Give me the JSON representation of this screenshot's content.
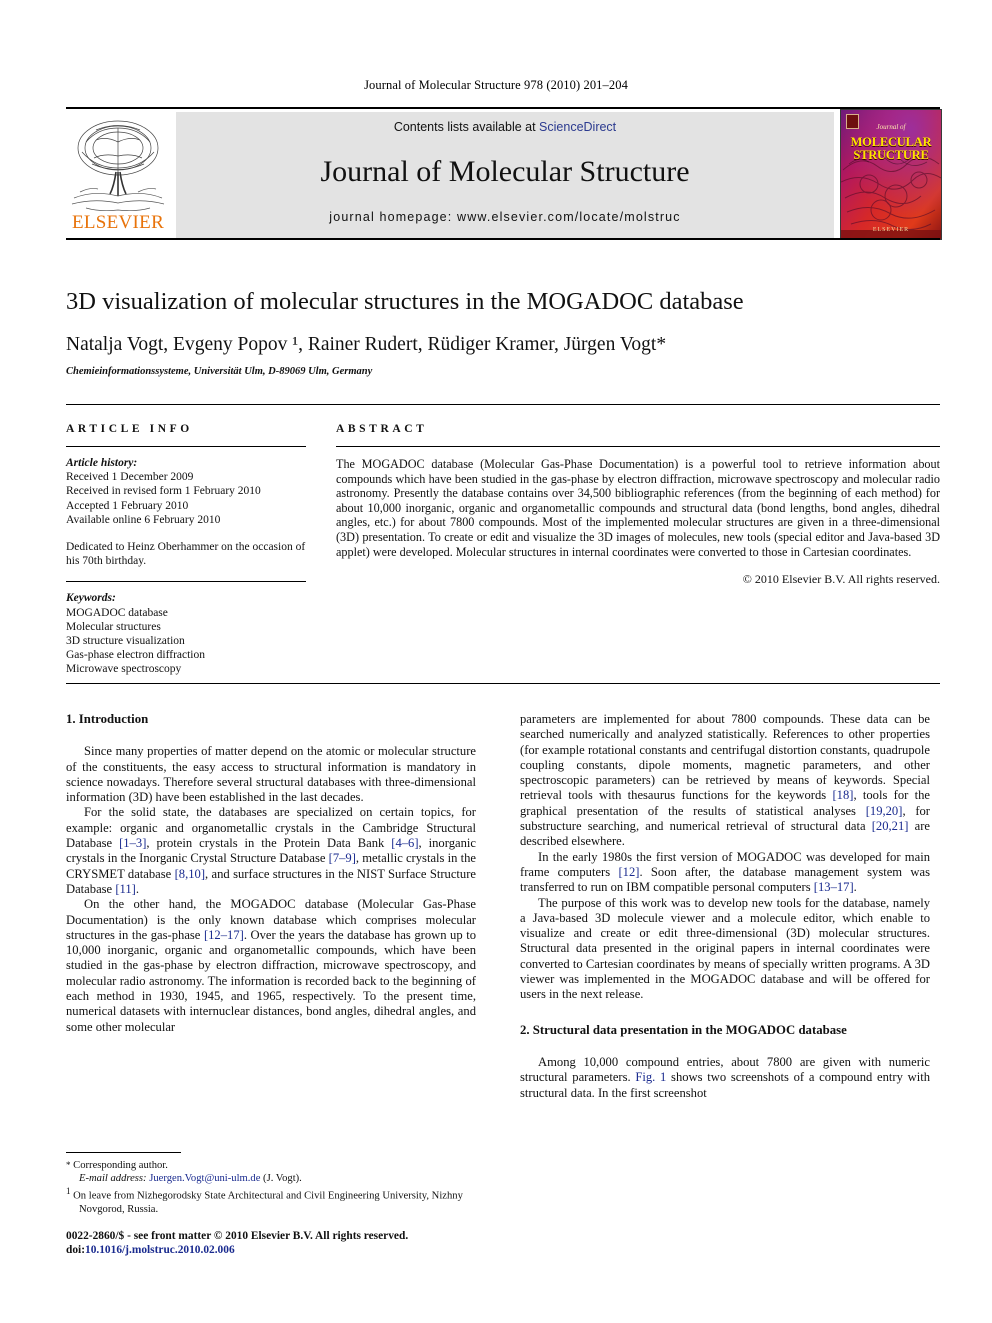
{
  "running_head": "Journal of Molecular Structure 978 (2010) 201–204",
  "masthead": {
    "contents_prefix": "Contents lists available at ",
    "sciencedirect": "ScienceDirect",
    "journal_title": "Journal of Molecular Structure",
    "homepage": "journal homepage: www.elsevier.com/locate/molstruc",
    "publisher_wordmark": "ELSEVIER",
    "cover": {
      "journal_of": "Journal of",
      "title_line1": "MOLECULAR",
      "title_line2": "STRUCTURE",
      "publisher": "ELSEVIER"
    },
    "link_color": "#2b3a8f",
    "elsevier_orange": "#E8730A"
  },
  "article": {
    "title": "3D visualization of molecular structures in the MOGADOC database",
    "authors": "Natalja Vogt, Evgeny Popov ¹, Rainer Rudert, Rüdiger Kramer, Jürgen Vogt*",
    "authors_plain": "Natalja Vogt, Evgeny Popov 1, Rainer Rudert, Rüdiger Kramer, Jürgen Vogt*",
    "affiliation": "Chemieinformationssysteme, Universität Ulm, D-89069 Ulm, Germany"
  },
  "info": {
    "label": "ARTICLE INFO",
    "history_heading": "Article history:",
    "history": [
      "Received 1 December 2009",
      "Received in revised form 1 February 2010",
      "Accepted 1 February 2010",
      "Available online 6 February 2010"
    ],
    "dedication": "Dedicated to Heinz Oberhammer on the occasion of his 70th birthday.",
    "keywords_heading": "Keywords:",
    "keywords": [
      "MOGADOC database",
      "Molecular structures",
      "3D structure visualization",
      "Gas-phase electron diffraction",
      "Microwave spectroscopy"
    ]
  },
  "abstract": {
    "label": "ABSTRACT",
    "text": "The MOGADOC database (Molecular Gas-Phase Documentation) is a powerful tool to retrieve information about compounds which have been studied in the gas-phase by electron diffraction, microwave spectroscopy and molecular radio astronomy. Presently the database contains over 34,500 bibliographic references (from the beginning of each method) for about 10,000 inorganic, organic and organometallic compounds and structural data (bond lengths, bond angles, dihedral angles, etc.) for about 7800 compounds. Most of the implemented molecular structures are given in a three-dimensional (3D) presentation. To create or edit and visualize the 3D images of molecules, new tools (special editor and Java-based 3D applet) were developed. Molecular structures in internal coordinates were converted to those in Cartesian coordinates.",
    "copyright": "© 2010 Elsevier B.V. All rights reserved."
  },
  "body": {
    "section1_heading": "1. Introduction",
    "p1": "Since many properties of matter depend on the atomic or molecular structure of the constituents, the easy access to structural information is mandatory in science nowadays. Therefore several structural databases with three-dimensional information (3D) have been established in the last decades.",
    "p2_a": "For the solid state, the databases are specialized on certain topics, for example: organic and organometallic crystals in the Cambridge Structural Database ",
    "p2_r1": "[1–3]",
    "p2_b": ", protein crystals in the Protein Data Bank ",
    "p2_r2": "[4–6]",
    "p2_c": ", inorganic crystals in the Inorganic Crystal Structure Database ",
    "p2_r3": "[7–9]",
    "p2_d": ", metallic crystals in the CRYSMET database ",
    "p2_r4": "[8,10]",
    "p2_e": ", and surface structures in the NIST Surface Structure Database ",
    "p2_r5": "[11]",
    "p2_f": ".",
    "p3_a": "On the other hand, the MOGADOC database (Molecular Gas-Phase Documentation) is the only known database which comprises molecular structures in the gas-phase ",
    "p3_r1": "[12–17]",
    "p3_b": ". Over the years the database has grown up to 10,000 inorganic, organic and organometallic compounds, which have been studied in the gas-phase by electron diffraction, microwave spectroscopy, and molecular radio astronomy. The information is recorded back to the beginning of each method in 1930, 1945, and 1965, respectively. To the present time, numerical datasets with internuclear distances, bond angles, dihedral angles, and some other molecular",
    "p4_a": "parameters are implemented for about 7800 compounds. These data can be searched numerically and analyzed statistically. References to other properties (for example rotational constants and centrifugal distortion constants, quadrupole coupling constants, dipole moments, magnetic parameters, and other spectroscopic parameters) can be retrieved by means of keywords. Special retrieval tools with thesaurus functions for the keywords ",
    "p4_r1": "[18]",
    "p4_b": ", tools for the graphical presentation of the results of statistical analyses ",
    "p4_r2": "[19,20]",
    "p4_c": ", for substructure searching, and numerical retrieval of structural data ",
    "p4_r3": "[20,21]",
    "p4_d": " are described elsewhere.",
    "p5_a": "In the early 1980s the first version of MOGADOC was developed for main frame computers ",
    "p5_r1": "[12]",
    "p5_b": ". Soon after, the database management system was transferred to run on IBM compatible personal computers ",
    "p5_r2": "[13–17]",
    "p5_c": ".",
    "p6": "The purpose of this work was to develop new tools for the database, namely a Java-based 3D molecule viewer and a molecule editor, which enable to visualize and create or edit three-dimensional (3D) molecular structures. Structural data presented in the original papers in internal coordinates were converted to Cartesian coordinates by means of specially written programs. A 3D viewer was implemented in the MOGADOC database and will be offered for users in the next release.",
    "section2_heading": "2. Structural data presentation in the MOGADOC database",
    "p7_a": "Among 10,000 compound entries, about 7800 are given with numeric structural parameters. ",
    "p7_fig": "Fig. 1",
    "p7_b": " shows two screenshots of a compound entry with structural data. In the first screenshot"
  },
  "footnotes": {
    "corresponding_mark": "*",
    "corresponding": "Corresponding author.",
    "email_label": "E-mail address:",
    "email": "Juergen.Vogt@uni-ulm.de",
    "email_suffix": " (J. Vogt).",
    "note1_mark": "1",
    "note1": "On leave from Nizhegorodsky State Architectural and Civil Engineering University, Nizhny Novgorod, Russia."
  },
  "footer": {
    "issn_line": "0022-2860/$ - see front matter © 2010 Elsevier B.V. All rights reserved.",
    "doi_label": "doi:",
    "doi": "10.1016/j.molstruc.2010.02.006"
  }
}
